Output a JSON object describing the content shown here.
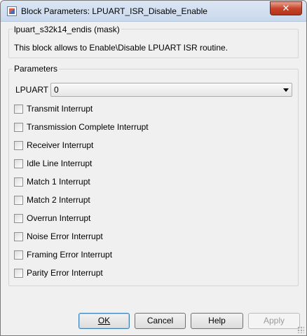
{
  "window": {
    "title": "Block Parameters: LPUART_ISR_Disable_Enable",
    "close_label": "✕"
  },
  "description_group": {
    "legend": "lpuart_s32k14_endis (mask)",
    "text": "This block allows to Enable\\Disable LPUART ISR routine."
  },
  "parameters_group": {
    "legend": "Parameters",
    "lpuart_label": "LPUART",
    "lpuart_value": "0",
    "checkboxes": [
      {
        "label": "Transmit Interrupt",
        "checked": false
      },
      {
        "label": "Transmission Complete Interrupt",
        "checked": false
      },
      {
        "label": "Receiver Interrupt",
        "checked": false
      },
      {
        "label": "Idle Line Interrupt",
        "checked": false
      },
      {
        "label": "Match 1 Interrupt",
        "checked": false
      },
      {
        "label": "Match 2 Interrupt",
        "checked": false
      },
      {
        "label": "Overrun Interrupt",
        "checked": false
      },
      {
        "label": "Noise Error Interrupt",
        "checked": false
      },
      {
        "label": "Framing Error Interrupt",
        "checked": false
      },
      {
        "label": "Parity Error Interrupt",
        "checked": false
      }
    ]
  },
  "buttons": {
    "ok": "OK",
    "cancel": "Cancel",
    "help": "Help",
    "apply": "Apply"
  }
}
